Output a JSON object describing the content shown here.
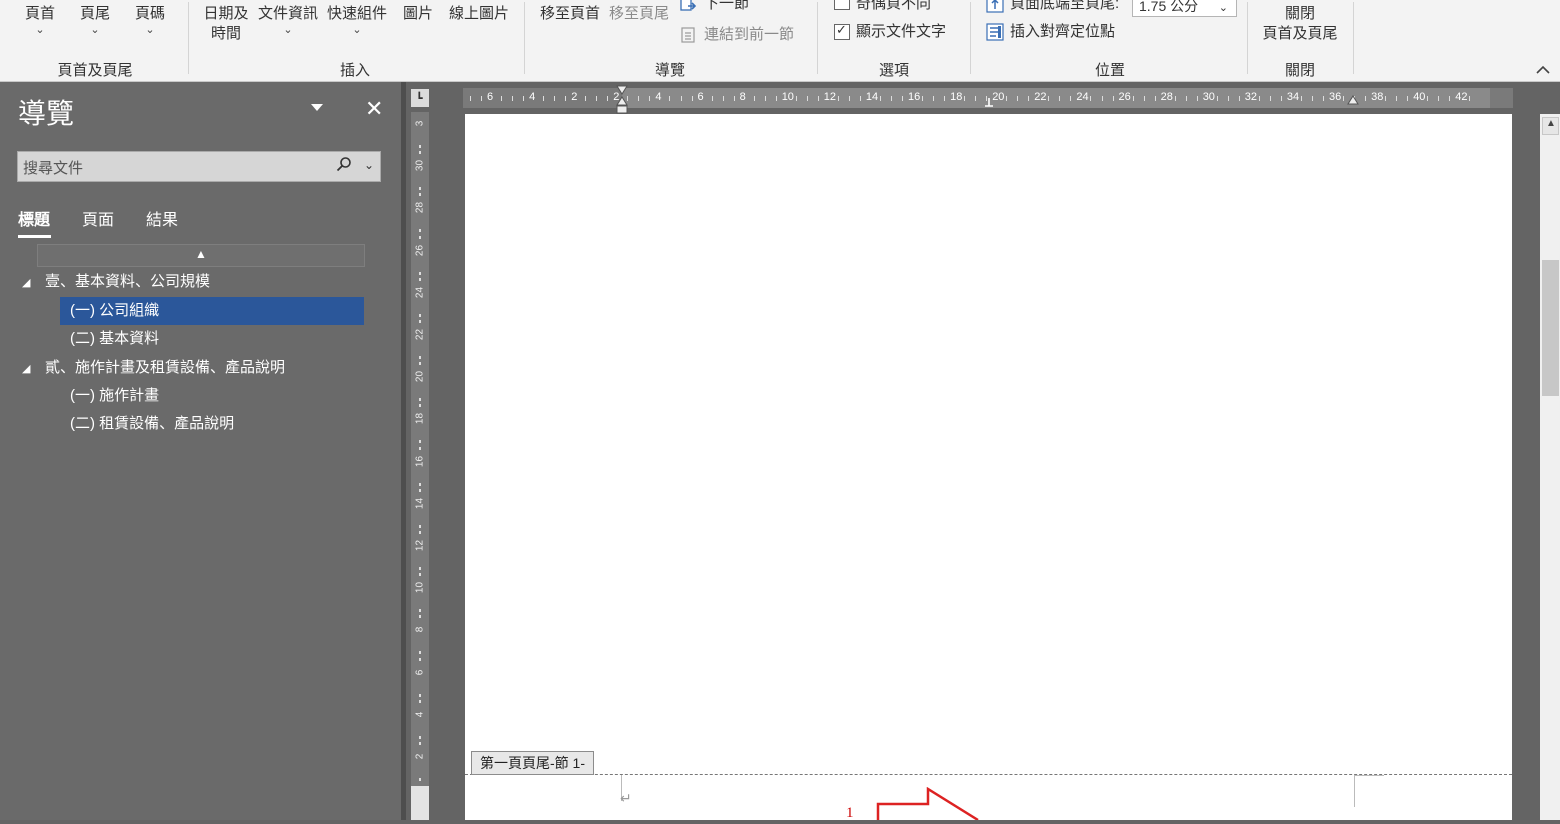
{
  "ribbon": {
    "groups": {
      "header_footer": {
        "label": "頁首及頁尾",
        "buttons": [
          "頁首",
          "頁尾",
          "頁碼"
        ]
      },
      "insert": {
        "label": "插入",
        "date_time_line1": "日期及",
        "date_time_line2": "時間",
        "doc_info": "文件資訊",
        "quick_parts": "快速組件",
        "pictures": "圖片",
        "online_pictures": "線上圖片"
      },
      "navigation": {
        "label": "導覽",
        "goto_header": "移至頁首",
        "goto_footer": "移至頁尾",
        "next_section": "下一節",
        "link_previous": "連結到前一節"
      },
      "options": {
        "label": "選項",
        "odd_even": "奇偶頁不同",
        "show_doc_text": "顯示文件文字"
      },
      "position": {
        "label": "位置",
        "footer_from_bottom": "頁面底端至頁尾:",
        "footer_value": "1.75 公分",
        "insert_align_tab": "插入對齊定位點"
      },
      "close": {
        "label": "關閉",
        "close_line1": "關閉",
        "close_line2": "頁首及頁尾"
      }
    },
    "collapse_icon": "chevron-up-icon"
  },
  "nav": {
    "title": "導覽",
    "search_placeholder": "搜尋文件",
    "tabs": [
      "標題",
      "頁面",
      "結果"
    ],
    "active_tab": "標題",
    "tree": [
      {
        "label": "壹、基本資料、公司規模",
        "level": 1
      },
      {
        "label": "(一) 公司組織",
        "level": 2,
        "selected": true
      },
      {
        "label": "(二) 基本資料",
        "level": 2
      },
      {
        "label": "貳、施作計畫及租賃設備、產品說明",
        "level": 1
      },
      {
        "label": "(一) 施作計畫",
        "level": 2
      },
      {
        "label": "(二) 租賃設備、產品說明",
        "level": 2
      }
    ]
  },
  "ruler": {
    "horizontal_labels": [
      "6",
      "4",
      "2",
      "2",
      "4",
      "6",
      "8",
      "10",
      "12",
      "14",
      "16",
      "18",
      "20",
      "22",
      "24",
      "26",
      "28",
      "30",
      "32",
      "34",
      "36",
      "38",
      "40",
      "42"
    ],
    "vertical_labels": [
      "3",
      "30",
      "28",
      "26",
      "24",
      "22",
      "20",
      "18",
      "16",
      "14",
      "12",
      "10",
      "8",
      "6",
      "4",
      "2"
    ]
  },
  "document": {
    "footer_tag": "第一頁頁尾-節 1-",
    "footnote_number": "1"
  },
  "colors": {
    "selection": "#2b579a",
    "nav_background": "#6a6a6a",
    "annotation_red": "#dd2222"
  }
}
